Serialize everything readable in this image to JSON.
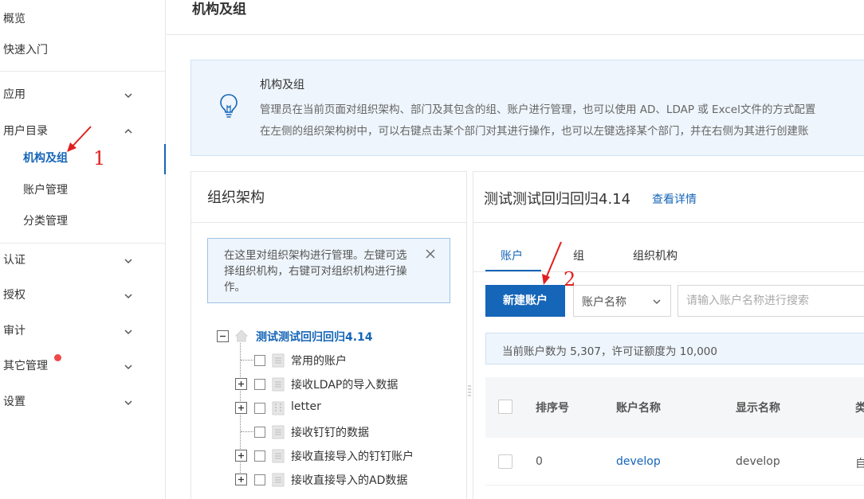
{
  "sidebar": {
    "overview": "概览",
    "quickstart": "快速入门",
    "apps": "应用",
    "user_directory": "用户目录",
    "org_groups": "机构及组",
    "account_mgmt": "账户管理",
    "category_mgmt": "分类管理",
    "auth": "认证",
    "authorization": "授权",
    "audit": "审计",
    "other_mgmt": "其它管理",
    "settings": "设置"
  },
  "header": {
    "title": "机构及组"
  },
  "info": {
    "title": "机构及组",
    "line1": "管理员在当前页面对组织架构、部门及其包含的组、账户进行管理，也可以使用 AD、LDAP 或 Excel文件的方式配置",
    "line2": "在左侧的组织架构树中，可以右键点击某个部门对其进行操作，也可以左键选择某个部门，并在右侧为其进行创建账"
  },
  "org_panel": {
    "title": "组织架构",
    "tip": "在这里对组织架构进行管理。左键可选择组织机构，右键可对组织机构进行操作。",
    "tree": {
      "root": "测试测试回归回归4.14",
      "children": [
        "常用的账户",
        "接收LDAP的导入数据",
        "letter",
        "接收钉钉的数据",
        "接收直接导入的钉钉账户",
        "接收直接导入的AD数据"
      ]
    }
  },
  "detail": {
    "title": "测试测试回归回归4.14",
    "view_details": "查看详情",
    "tabs": [
      "账户",
      "组",
      "组织机构"
    ],
    "new_account": "新建账户",
    "filter_select": "账户名称",
    "search_placeholder": "请输入账户名称进行搜索",
    "count_text": "当前账户数为 5,307，许可证额度为 10,000",
    "columns": [
      "排序号",
      "账户名称",
      "显示名称",
      "类"
    ],
    "rows": [
      {
        "order": "0",
        "account": "develop",
        "display": "develop",
        "type": "自"
      }
    ]
  },
  "annotations": {
    "one": "1",
    "two": "2"
  },
  "colors": {
    "accent": "#1565b8",
    "annotation": "#e02020",
    "badge": "#f04848"
  }
}
